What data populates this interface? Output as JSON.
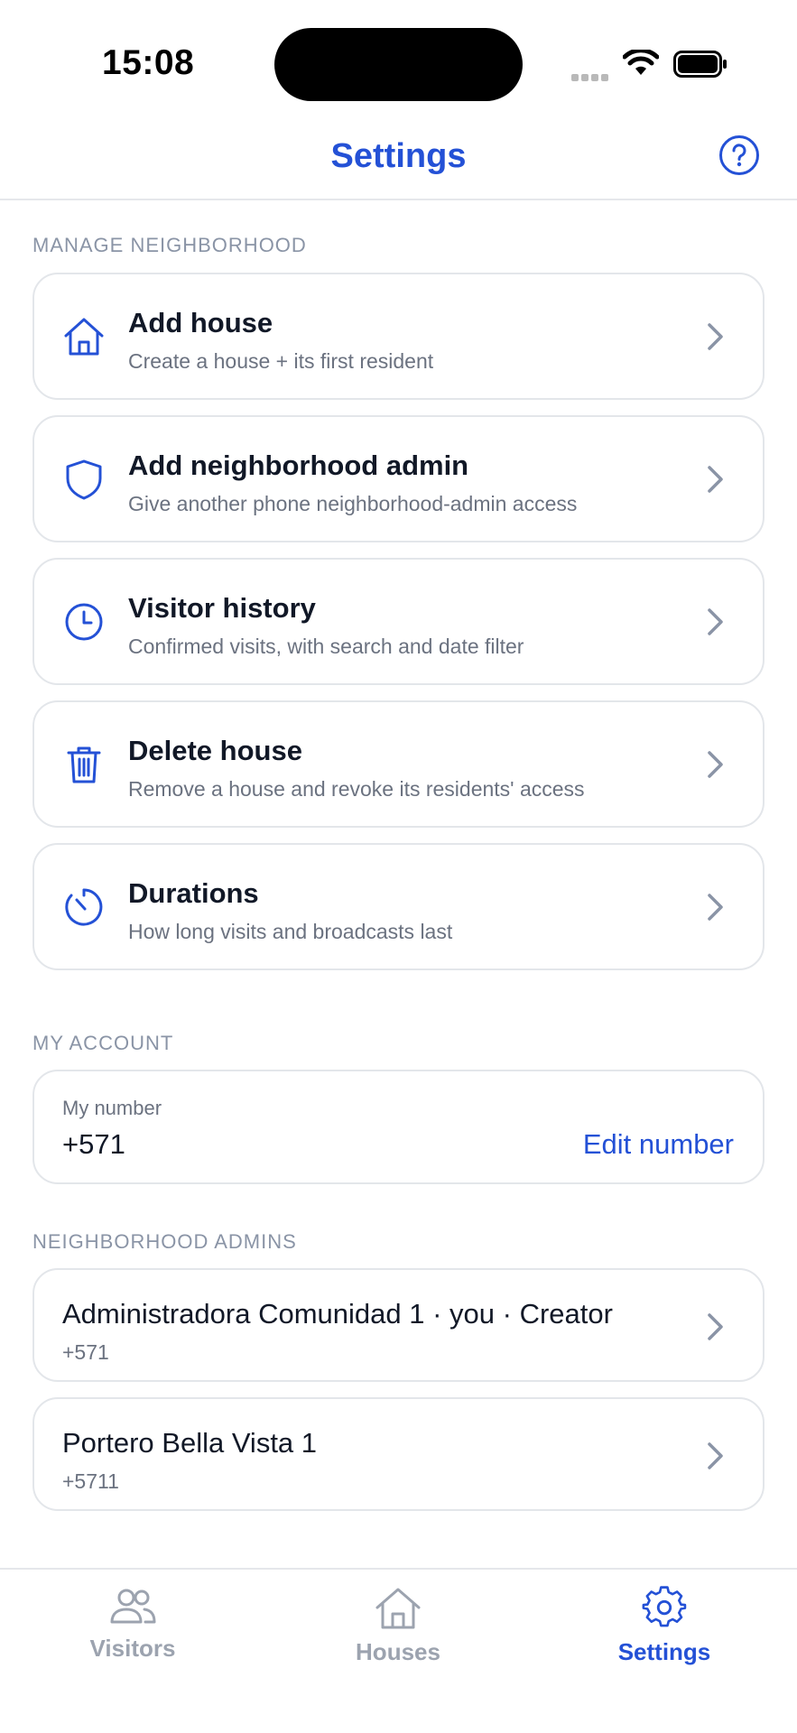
{
  "status_bar": {
    "time": "15:08"
  },
  "header": {
    "title": "Settings",
    "help_icon": "question-circle-icon"
  },
  "sections": {
    "manage_label": "MANAGE NEIGHBORHOOD",
    "account_label": "MY ACCOUNT",
    "admins_label": "NEIGHBORHOOD ADMINS"
  },
  "menu": [
    {
      "title": "Add house",
      "subtitle": "Create a house + its first resident",
      "icon": "house-icon"
    },
    {
      "title": "Add neighborhood admin",
      "subtitle": "Give another phone neighborhood-admin access",
      "icon": "shield-icon"
    },
    {
      "title": "Visitor history",
      "subtitle": "Confirmed visits, with search and date filter",
      "icon": "clock-icon"
    },
    {
      "title": "Delete house",
      "subtitle": "Remove a house and revoke its residents' access",
      "icon": "trash-icon"
    },
    {
      "title": "Durations",
      "subtitle": "How long visits and broadcasts last",
      "icon": "timer-icon"
    }
  ],
  "account": {
    "label": "My number",
    "number": "+571",
    "edit_label": "Edit number"
  },
  "admins": [
    {
      "name": "Administradora Comunidad 1 · you · Creator",
      "phone": "+571"
    },
    {
      "name": "Portero Bella Vista 1",
      "phone": "+5711"
    }
  ],
  "tabs": [
    {
      "label": "Visitors",
      "icon": "people-icon",
      "active": false
    },
    {
      "label": "Houses",
      "icon": "house-icon",
      "active": false
    },
    {
      "label": "Settings",
      "icon": "gear-icon",
      "active": true
    }
  ],
  "colors": {
    "accent": "#2451d6",
    "muted": "#6b7280",
    "border": "#e3e6ea"
  }
}
